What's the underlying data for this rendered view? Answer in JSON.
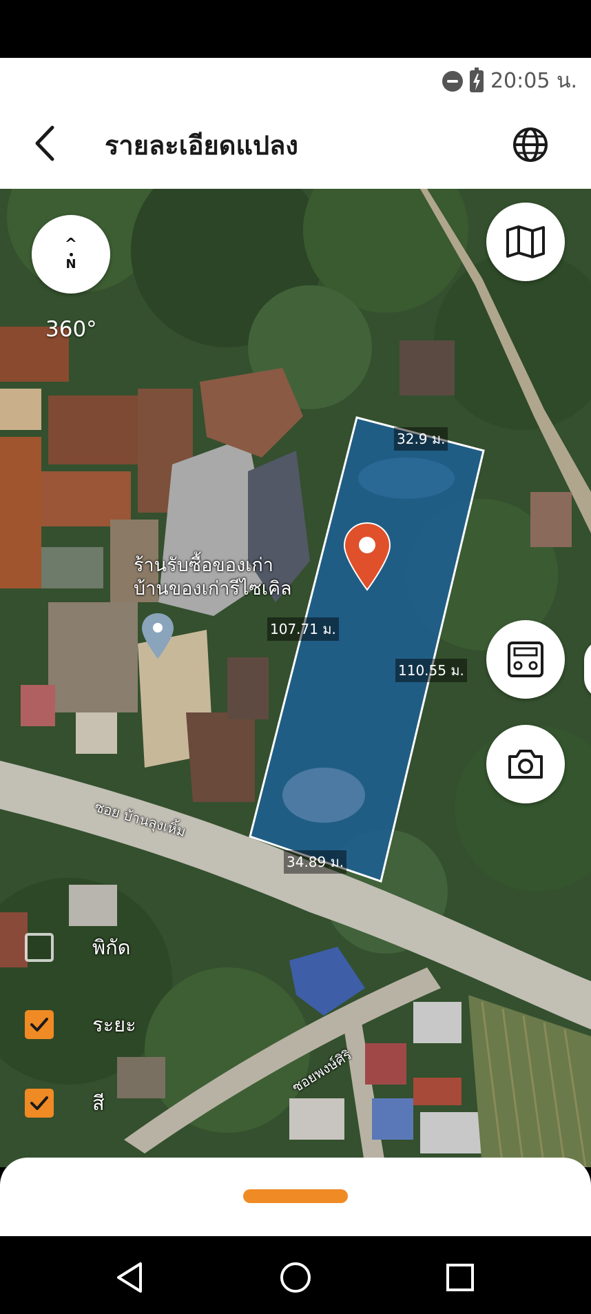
{
  "status_bar": {
    "time": "20:05 น."
  },
  "header": {
    "title": "รายละเอียดแปลง"
  },
  "map": {
    "rotation": "360°",
    "compass_letter": "N",
    "place_name_line1": "ร้านรับซื้อของเก่า",
    "place_name_line2": "บ้านของเก่ารีไซเคิล",
    "road_1": "ซอย บ้านลุงเหิ้ม",
    "road_2": "ซอยพงษ์ศิริ",
    "distances": {
      "top": "32.9 ม.",
      "left": "107.71 ม.",
      "right": "110.55 ม.",
      "bottom": "34.89 ม."
    }
  },
  "layers": [
    {
      "label": "พิกัด",
      "checked": false
    },
    {
      "label": "ระยะ",
      "checked": true
    },
    {
      "label": "สี",
      "checked": true
    }
  ],
  "colors": {
    "accent": "#f08a24",
    "plot_fill": "#1e5f92",
    "pin": "#e0502a"
  },
  "icons": [
    "back-arrow-icon",
    "globe-icon",
    "map-icon",
    "calculator-icon",
    "camera-icon",
    "location-pin-icon",
    "building-pin-icon"
  ]
}
